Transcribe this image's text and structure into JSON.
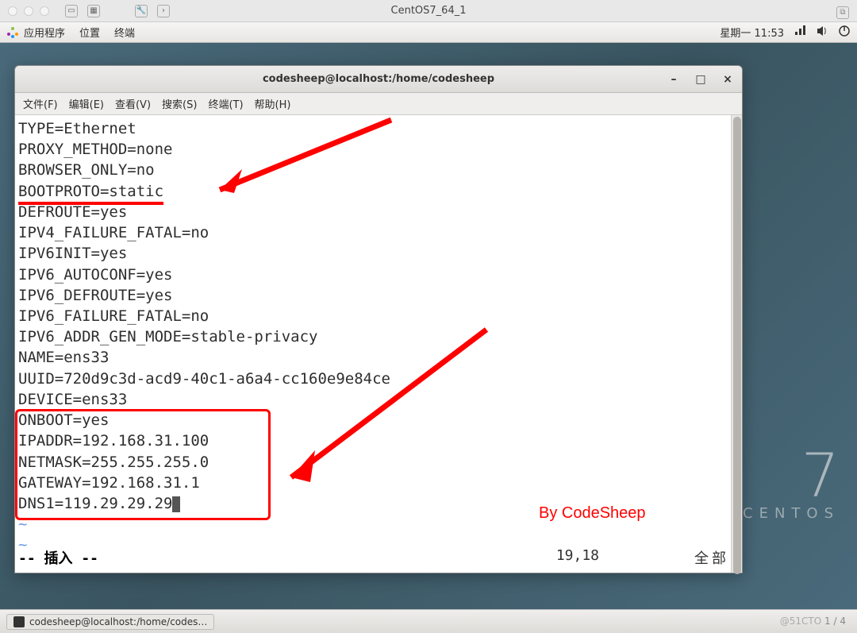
{
  "mac_chrome": {
    "title": "CentOS7_64_1"
  },
  "gnome_panel": {
    "applications": "应用程序",
    "places": "位置",
    "terminal": "终端",
    "clock": "星期一 11:53"
  },
  "terminal": {
    "title": "codesheep@localhost:/home/codesheep",
    "menu": {
      "file": "文件(F)",
      "edit": "编辑(E)",
      "view": "查看(V)",
      "search": "搜索(S)",
      "terminal": "终端(T)",
      "help": "帮助(H)"
    },
    "lines": {
      "l1": "TYPE=Ethernet",
      "l2": "PROXY_METHOD=none",
      "l3": "BROWSER_ONLY=no",
      "l4": "BOOTPROTO=static",
      "l5": "DEFROUTE=yes",
      "l6": "IPV4_FAILURE_FATAL=no",
      "l7": "IPV6INIT=yes",
      "l8": "IPV6_AUTOCONF=yes",
      "l9": "IPV6_DEFROUTE=yes",
      "l10": "IPV6_FAILURE_FATAL=no",
      "l11": "IPV6_ADDR_GEN_MODE=stable-privacy",
      "l12": "NAME=ens33",
      "l13": "UUID=720d9c3d-acd9-40c1-a6a4-cc160e9e84ce",
      "l14": "DEVICE=ens33",
      "l15": "ONBOOT=yes",
      "l16": "IPADDR=192.168.31.100",
      "l17": "NETMASK=255.255.255.0",
      "l18": "GATEWAY=192.168.31.1",
      "l19": "DNS1=119.29.29.29"
    },
    "status": {
      "mode": "-- 插入 --",
      "position": "19,18",
      "scroll": "全部"
    }
  },
  "watermark": "By CodeSheep",
  "centos": {
    "seven": "7",
    "label": "CENTOS"
  },
  "taskbar": {
    "item": "codesheep@localhost:/home/codes…"
  },
  "page_info": {
    "prefix": "@51CTO",
    "page": "1 / 4"
  }
}
